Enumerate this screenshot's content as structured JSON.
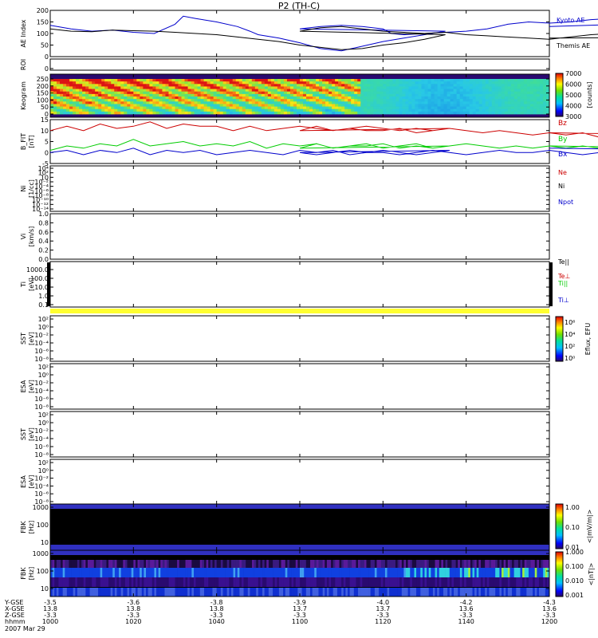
{
  "title": "P2 (TH-C)",
  "chart_data": [
    {
      "type": "line",
      "id": "ae",
      "ylabel": "AE Index",
      "ylim": [
        0,
        200
      ],
      "ticks": [
        "0",
        "50",
        "100",
        "150",
        "200"
      ],
      "series": [
        {
          "name": "Kyoto AE",
          "color": "#0000cc",
          "x": [
            1000,
            1005,
            1010,
            1015,
            1020,
            1025,
            1030,
            1032,
            1035,
            1040,
            1045,
            1048,
            1050,
            1055,
            1060,
            1065,
            1070,
            1075,
            1080,
            1085,
            1090,
            1095,
            1100,
            1105,
            1110,
            1115,
            1120,
            1122,
            1125,
            1130,
            1135,
            1140,
            1145,
            1150,
            1155,
            1160,
            1165,
            1170,
            1175,
            1180,
            1185,
            1190,
            1195,
            1200
          ],
          "y": [
            135,
            120,
            110,
            115,
            105,
            100,
            140,
            175,
            165,
            150,
            130,
            110,
            95,
            80,
            60,
            35,
            25,
            45,
            65,
            80,
            95,
            110,
            120,
            130,
            135,
            130,
            120,
            100,
            95,
            100,
            105,
            110,
            120,
            140,
            150,
            145,
            150,
            160,
            165,
            175,
            170,
            130,
            150,
            130
          ]
        },
        {
          "name": "Themis AE",
          "color": "#000000",
          "x": [
            1000,
            1005,
            1010,
            1015,
            1020,
            1025,
            1030,
            1035,
            1040,
            1045,
            1050,
            1055,
            1060,
            1065,
            1070,
            1075,
            1080,
            1085,
            1090,
            1095,
            1100,
            1105,
            1110,
            1115,
            1120,
            1125,
            1130,
            1135,
            1140,
            1145,
            1150,
            1155,
            1160,
            1165,
            1170,
            1175,
            1180,
            1185,
            1190,
            1195,
            1200
          ],
          "y": [
            120,
            110,
            108,
            115,
            112,
            110,
            105,
            100,
            95,
            85,
            75,
            65,
            50,
            40,
            30,
            35,
            50,
            60,
            75,
            95,
            110,
            125,
            130,
            120,
            110,
            105,
            100,
            105,
            95,
            90,
            85,
            80,
            75,
            85,
            95,
            100,
            105,
            95,
            90,
            85,
            80
          ]
        }
      ]
    },
    {
      "type": "line",
      "id": "roi",
      "ylabel": "ROI",
      "ticks": [
        "0"
      ],
      "series": []
    },
    {
      "type": "heatmap",
      "id": "keogram",
      "ylabel": "Keogram",
      "ylim": [
        0,
        250
      ],
      "ticks": [
        "0",
        "50",
        "100",
        "150",
        "200",
        "250"
      ],
      "colorbar": {
        "label": "[counts]",
        "ticks": [
          "3000",
          "4000",
          "5000",
          "6000",
          "7000"
        ],
        "range": [
          3000,
          7000
        ]
      }
    },
    {
      "type": "line",
      "id": "bfield",
      "ylabel": "B_FIT",
      "units": "[nT]",
      "ylim": [
        -5,
        15
      ],
      "ticks": [
        "-5",
        "0",
        "5",
        "10",
        "15"
      ],
      "series": [
        {
          "name": "Bz",
          "color": "#cc0000",
          "x": [
            1000,
            1004,
            1008,
            1012,
            1016,
            1020,
            1024,
            1028,
            1032,
            1036,
            1040,
            1044,
            1048,
            1052,
            1056,
            1060,
            1064,
            1068,
            1072,
            1076,
            1080,
            1084,
            1088,
            1092,
            1096,
            1100,
            1104,
            1108,
            1112,
            1116,
            1120,
            1124,
            1128,
            1132,
            1136,
            1140,
            1144,
            1148,
            1152,
            1156,
            1160,
            1164,
            1168,
            1172,
            1176,
            1180,
            1184,
            1188,
            1192,
            1196,
            1200
          ],
          "y": [
            10,
            12,
            10,
            13,
            11,
            12,
            14,
            11,
            13,
            12,
            12,
            10,
            12,
            10,
            11,
            12,
            11,
            10,
            11,
            12,
            11,
            10,
            11,
            10,
            11,
            10,
            12,
            10,
            11,
            10,
            10,
            11,
            9,
            10,
            11,
            10,
            9,
            10,
            9,
            8,
            9,
            8,
            9,
            7,
            8,
            9,
            7,
            8,
            9,
            8,
            9
          ]
        },
        {
          "name": "By",
          "color": "#00cc00",
          "x": [
            1000,
            1004,
            1008,
            1012,
            1016,
            1020,
            1024,
            1028,
            1032,
            1036,
            1040,
            1044,
            1048,
            1052,
            1056,
            1060,
            1064,
            1068,
            1072,
            1076,
            1080,
            1084,
            1088,
            1092,
            1096,
            1100,
            1104,
            1108,
            1112,
            1116,
            1120,
            1124,
            1128,
            1132,
            1136,
            1140,
            1144,
            1148,
            1152,
            1156,
            1160,
            1164,
            1168,
            1172,
            1176,
            1180,
            1184,
            1188,
            1192,
            1196,
            1200
          ],
          "y": [
            1,
            3,
            2,
            4,
            3,
            6,
            3,
            4,
            5,
            3,
            4,
            3,
            5,
            2,
            4,
            3,
            4,
            2,
            3,
            4,
            2,
            3,
            4,
            2,
            3,
            2,
            4,
            2,
            3,
            3,
            4,
            2,
            3,
            2,
            3,
            4,
            3,
            2,
            3,
            2,
            3,
            2,
            3,
            2,
            3,
            2,
            1,
            2,
            3,
            2,
            3
          ]
        },
        {
          "name": "Bx",
          "color": "#0000cc",
          "x": [
            1000,
            1004,
            1008,
            1012,
            1016,
            1020,
            1024,
            1028,
            1032,
            1036,
            1040,
            1044,
            1048,
            1052,
            1056,
            1060,
            1064,
            1068,
            1072,
            1076,
            1080,
            1084,
            1088,
            1092,
            1096,
            1100,
            1104,
            1108,
            1112,
            1116,
            1120,
            1124,
            1128,
            1132,
            1136,
            1140,
            1144,
            1148,
            1152,
            1156,
            1160,
            1164,
            1168,
            1172,
            1176,
            1180,
            1184,
            1188,
            1192,
            1196,
            1200
          ],
          "y": [
            0,
            1,
            -1,
            1,
            0,
            2,
            -1,
            1,
            0,
            1,
            -1,
            0,
            1,
            0,
            -1,
            1,
            0,
            1,
            -1,
            0,
            1,
            0,
            -1,
            0,
            1,
            0,
            -1,
            0,
            1,
            0,
            0,
            -1,
            0,
            1,
            0,
            -1,
            0,
            1,
            0,
            0,
            1,
            0,
            -1,
            0,
            1,
            0,
            0,
            1,
            0,
            1,
            2
          ]
        }
      ]
    },
    {
      "type": "line",
      "id": "ni",
      "ylabel": "Ni",
      "units": "[1/cc]",
      "ticks": [
        "10⁴",
        "10²",
        "10",
        "10⁻²",
        "10⁻⁴",
        "10⁻⁶",
        "10⁻⁸",
        "10⁻¹⁰",
        "10⁻¹²",
        "10⁻¹⁴"
      ],
      "legend": [
        {
          "name": "Ne",
          "color": "#cc0000"
        },
        {
          "name": "Ni",
          "color": "#000000"
        },
        {
          "name": "Npot",
          "color": "#0000cc"
        }
      ],
      "series": []
    },
    {
      "type": "line",
      "id": "vi",
      "ylabel": "Vi",
      "units": "[km/s]",
      "ylim": [
        0,
        1
      ],
      "ticks": [
        "0.0",
        "0.2",
        "0.4",
        "0.6",
        "0.8",
        "1.0"
      ],
      "series": []
    },
    {
      "type": "line",
      "id": "ti",
      "ylabel": "Ti",
      "units": "[eV]",
      "ticks": [
        "0.1",
        "1.0",
        "10.0",
        "100.0",
        "1000.0"
      ],
      "legend": [
        {
          "name": "Te||",
          "color": "#000000"
        },
        {
          "name": "Te⊥",
          "color": "#cc0000"
        },
        {
          "name": "Ti||",
          "color": "#00cc00"
        },
        {
          "name": "Ti⊥",
          "color": "#0000cc"
        }
      ],
      "series": []
    },
    {
      "type": "heatmap",
      "id": "sst1",
      "ylabel": "SST",
      "units": "[eV]",
      "ticks": [
        "10²",
        "10⁰",
        "10⁻²",
        "10⁻⁴",
        "10⁻⁶",
        "10⁻⁸"
      ],
      "colorbar": {
        "label": "Eflux, EFU",
        "ticks": [
          "10⁶",
          "10⁴",
          "10²",
          "10⁰"
        ]
      }
    },
    {
      "type": "heatmap",
      "id": "esa1",
      "ylabel": "ESA",
      "units": "[eV]",
      "ticks": [
        "10²",
        "10⁰",
        "10⁻²",
        "10⁻⁴",
        "10⁻⁶",
        "10⁻⁸"
      ]
    },
    {
      "type": "heatmap",
      "id": "sst2",
      "ylabel": "SST",
      "units": "[eV]",
      "ticks": [
        "10²",
        "10⁰",
        "10⁻²",
        "10⁻⁴",
        "10⁻⁶",
        "10⁻⁸"
      ]
    },
    {
      "type": "heatmap",
      "id": "esa2",
      "ylabel": "ESA",
      "units": "[eV]",
      "ticks": [
        "10²",
        "10⁰",
        "10⁻²",
        "10⁻⁴",
        "10⁻⁶",
        "10⁻⁸"
      ]
    },
    {
      "type": "heatmap",
      "id": "fbk1",
      "ylabel": "FBK",
      "units": "[Hz]",
      "ticks": [
        "10",
        "100",
        "1000"
      ],
      "colorbar": {
        "label": "<|mV/m|>",
        "ticks": [
          "0.01",
          "0.10",
          "1.00"
        ]
      }
    },
    {
      "type": "heatmap",
      "id": "fbk2",
      "ylabel": "FBK",
      "units": "[Hz]",
      "ticks": [
        "10",
        "100",
        "1000"
      ],
      "colorbar": {
        "label": "<|nT|>",
        "ticks": [
          "0.001",
          "0.010",
          "0.100",
          "1.000"
        ]
      }
    }
  ],
  "xaxis": {
    "row_labels": [
      "Y-GSE",
      "X-GSE",
      "Z-GSE",
      "hhmm"
    ],
    "date": "2007 Mar 29",
    "ticks": [
      {
        "t": 1000,
        "rows": [
          "-3.5",
          "13.8",
          "-3.3",
          "1000"
        ]
      },
      {
        "t": 1020,
        "rows": [
          "-3.6",
          "13.8",
          "-3.3",
          "1020"
        ]
      },
      {
        "t": 1040,
        "rows": [
          "-3.8",
          "13.8",
          "-3.3",
          "1040"
        ]
      },
      {
        "t": 1100,
        "rows": [
          "-3.9",
          "13.7",
          "-3.3",
          "1100"
        ]
      },
      {
        "t": 1120,
        "rows": [
          "-4.0",
          "13.7",
          "-3.3",
          "1120"
        ]
      },
      {
        "t": 1140,
        "rows": [
          "-4.2",
          "13.6",
          "-3.3",
          "1140"
        ]
      },
      {
        "t": 1200,
        "rows": [
          "-4.3",
          "13.6",
          "-3.3",
          "1200"
        ]
      }
    ]
  }
}
